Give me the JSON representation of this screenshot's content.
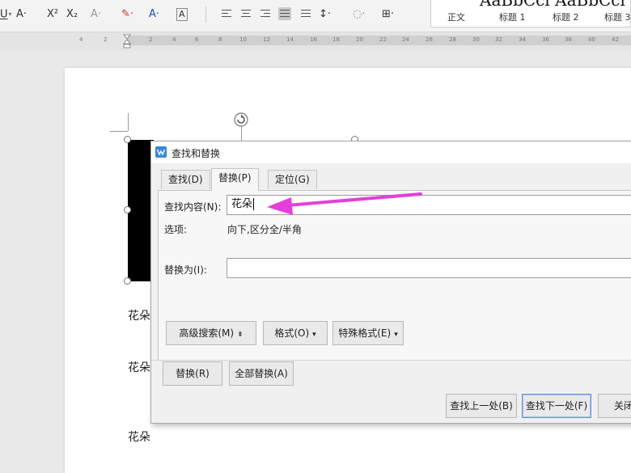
{
  "toolbar": {
    "font_color_btn": "A·",
    "superscript_btn": "X²",
    "subscript_btn": "X₂",
    "clear_format_btn": "A·",
    "highlight_btn": "✎·",
    "text_color_btn": "A·",
    "char_border_btn": "A",
    "line_spacing_btn": "↕·",
    "shading_btn": "◌·",
    "border_btn": "⊞·"
  },
  "styles": {
    "preview_text": "AaBbCcl AaBbCcl AaBbC",
    "items": [
      "正文",
      "标题 1",
      "标题 2",
      "标题 3"
    ]
  },
  "ruler": {
    "labels": [
      "4",
      "2",
      "2",
      "4",
      "6",
      "8",
      "10",
      "12",
      "14",
      "16",
      "18",
      "20",
      "22",
      "24",
      "26",
      "28",
      "30",
      "32",
      "34",
      "36",
      "38",
      "40",
      "42"
    ]
  },
  "document": {
    "lines": [
      "花朵",
      "花朵",
      "花朵"
    ],
    "side_icon": "🗎 ·"
  },
  "dialog": {
    "title": "查找和替换",
    "tabs": [
      "查找(D)",
      "替换(P)",
      "定位(G)"
    ],
    "find_label": "查找内容(N):",
    "find_value": "花朵",
    "options_label": "选项:",
    "options_value": "向下,区分全/半角",
    "replace_label": "替换为(I):",
    "replace_value": "",
    "buttons": {
      "advanced": "高级搜索(M)",
      "advanced_suffix": "⇟",
      "format": "格式(O)",
      "format_suffix": "▾",
      "special": "特殊格式(E)",
      "special_suffix": "▾",
      "replace": "替换(R)",
      "replace_all": "全部替换(A)",
      "find_prev": "查找上一处(B)",
      "find_next": "查找下一处(F)",
      "close": "关闭"
    }
  },
  "colors": {
    "arrow": "#e43fd9",
    "dialog_logo": "#3a87d9",
    "focus_border": "#6a8ed8"
  }
}
